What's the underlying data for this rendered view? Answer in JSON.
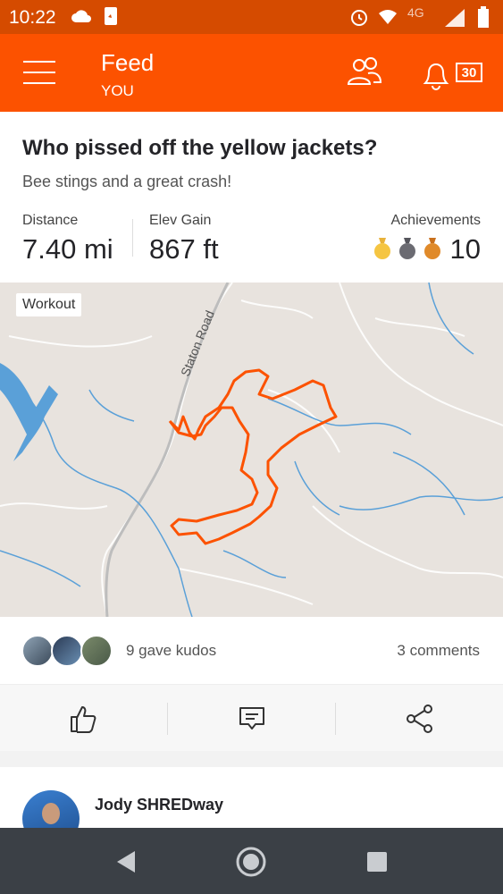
{
  "status_bar": {
    "time": "10:22",
    "network": "4G"
  },
  "app_bar": {
    "title": "Feed",
    "subtitle": "YOU",
    "notification_count": "30"
  },
  "activity": {
    "title": "Who pissed off the yellow jackets?",
    "description": "Bee stings and a great crash!",
    "stats": {
      "distance_label": "Distance",
      "distance_value": "7.40 mi",
      "elev_label": "Elev Gain",
      "elev_value": "867 ft",
      "achievements_label": "Achievements",
      "achievements_value": "10"
    },
    "map": {
      "badge": "Workout",
      "road_label": "Staton Road",
      "route_color": "#fc5200"
    },
    "kudos_text": "9 gave kudos",
    "comments_text": "3 comments"
  },
  "next_post": {
    "athlete_name": "Jody SHREDway"
  },
  "colors": {
    "brand": "#fc5200",
    "status_bar": "#d54b00",
    "nav_bar": "#3b4046",
    "gold": "#f5c542",
    "silver": "#6b6b72",
    "bronze": "#e08a2a"
  }
}
